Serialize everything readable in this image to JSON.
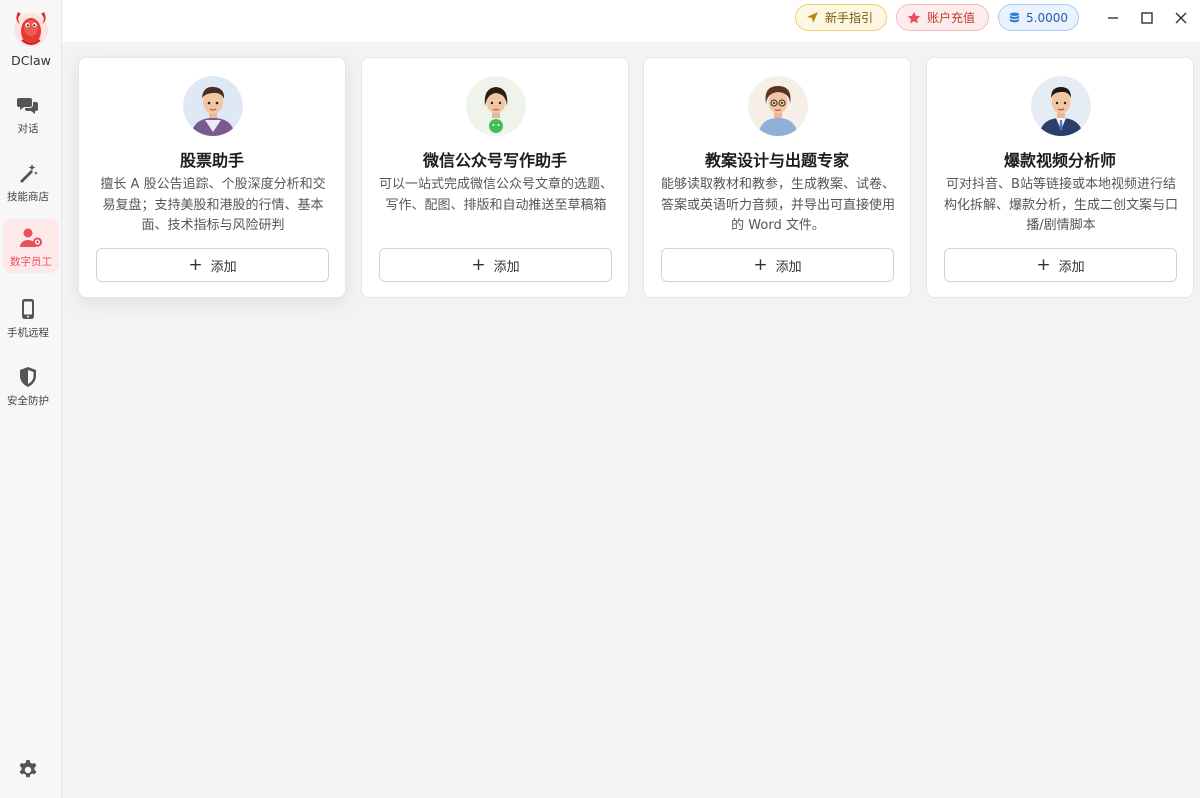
{
  "app": {
    "name": "DClaw"
  },
  "sidebar": {
    "items": [
      {
        "label": "对话",
        "icon": "chat-icon"
      },
      {
        "label": "技能商店",
        "icon": "magic-wand-icon"
      },
      {
        "label": "数字员工",
        "icon": "user-gear-icon",
        "active": true
      },
      {
        "label": "手机远程",
        "icon": "phone-icon"
      },
      {
        "label": "安全防护",
        "icon": "shield-icon"
      }
    ],
    "settings_icon": "gear-icon"
  },
  "topbar": {
    "guide_label": "新手指引",
    "recharge_label": "账户充值",
    "balance": "5.0000"
  },
  "colors": {
    "accent": "#e8505b",
    "guide": "#f0cf6e",
    "balance": "#2f7fd8"
  },
  "cards": [
    {
      "title": "股票助手",
      "desc": "擅长 A 股公告追踪、个股深度分析和交易复盘；支持美股和港股的行情、基本面、技术指标与风险研判",
      "add_label": "添加"
    },
    {
      "title": "微信公众号写作助手",
      "desc": "可以一站式完成微信公众号文章的选题、写作、配图、排版和自动推送至草稿箱",
      "add_label": "添加"
    },
    {
      "title": "教案设计与出题专家",
      "desc": "能够读取教材和教参，生成教案、试卷、答案或英语听力音频，并导出可直接使用的 Word 文件。",
      "add_label": "添加"
    },
    {
      "title": "爆款视频分析师",
      "desc": "可对抖音、B站等链接或本地视频进行结构化拆解、爆款分析，生成二创文案与口播/剧情脚本",
      "add_label": "添加"
    }
  ]
}
